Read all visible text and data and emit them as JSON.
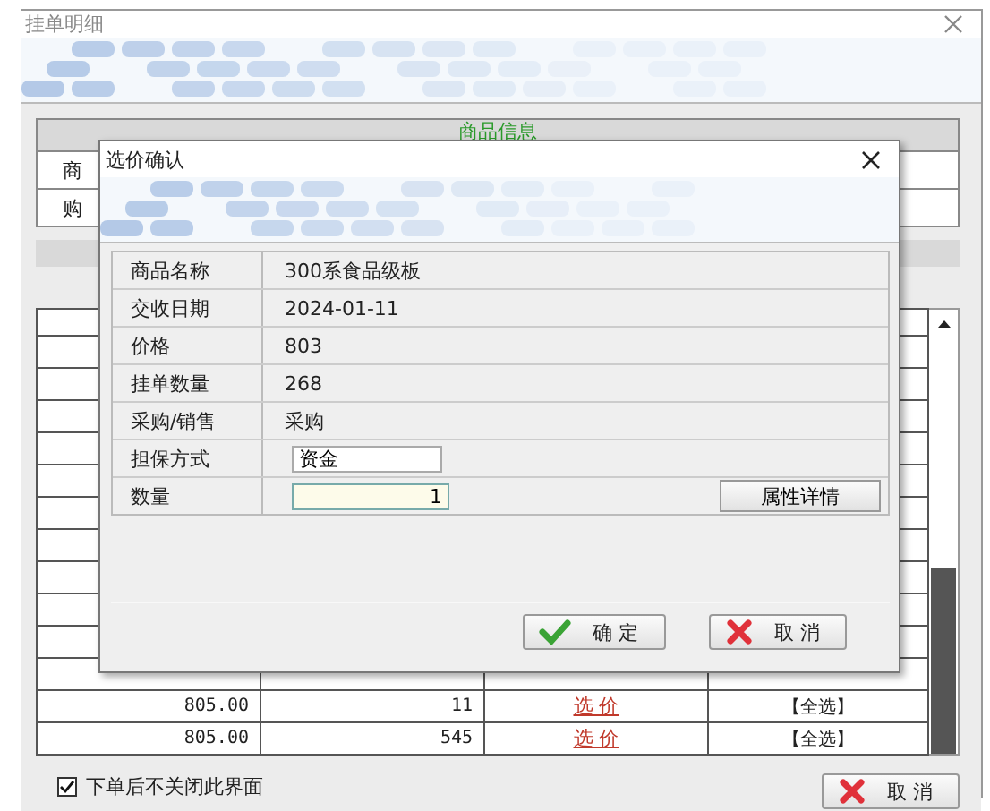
{
  "window": {
    "title": "挂单明细"
  },
  "product_info": {
    "header": "商品信息",
    "rows": [
      {
        "label": "商"
      },
      {
        "label": "购"
      }
    ]
  },
  "orders": {
    "rows": [
      {
        "price": "805.00",
        "quantity": "11",
        "action": "选 价",
        "select": "【全选】"
      },
      {
        "price": "805.00",
        "quantity": "545",
        "action": "选 价",
        "select": "【全选】"
      }
    ]
  },
  "keep_open": {
    "label": "下单后不关闭此界面",
    "checked": true
  },
  "cancel_button": "取 消",
  "dialog": {
    "title": "选价确认",
    "fields": [
      {
        "label": "商品名称",
        "value": "300系食品级板",
        "kind": "text"
      },
      {
        "label": "交收日期",
        "value": "2024-01-11",
        "kind": "text"
      },
      {
        "label": "价格",
        "value": "803",
        "kind": "text"
      },
      {
        "label": "挂单数量",
        "value": "268",
        "kind": "text"
      },
      {
        "label": "采购/销售",
        "value": "采购",
        "kind": "text"
      },
      {
        "label": "担保方式",
        "value": "资金",
        "kind": "input"
      },
      {
        "label": "数量",
        "value": "1",
        "kind": "number"
      }
    ],
    "details_button": "属性详情",
    "buttons": [
      {
        "label": "确 定",
        "kind": "confirm"
      },
      {
        "label": "取 消",
        "kind": "cancel"
      }
    ]
  }
}
